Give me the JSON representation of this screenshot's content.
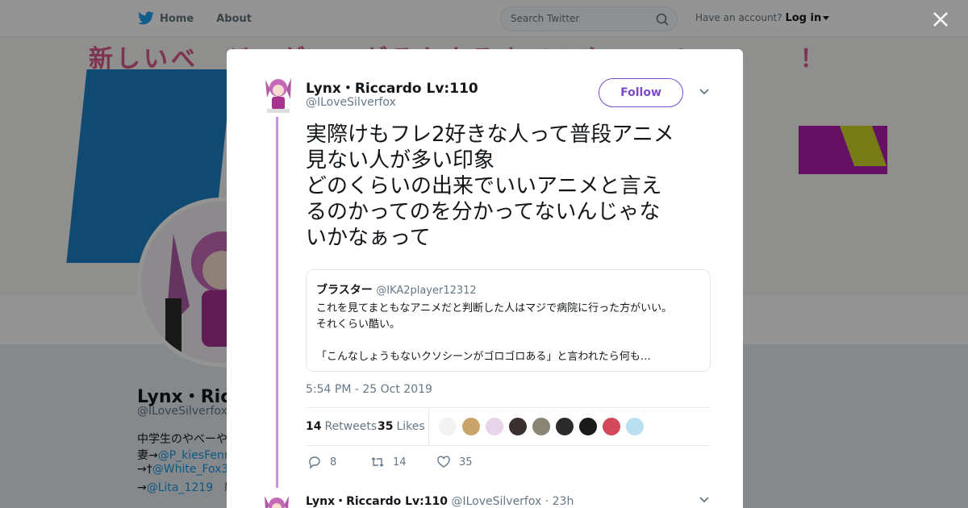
{
  "nav": {
    "home_label": "Home",
    "about_label": "About",
    "search_placeholder": "Search Twitter",
    "account_prompt": "Have an account?",
    "login_label": "Log in"
  },
  "background_profile": {
    "name": "Lynx・Ricc",
    "handle": "@ILoveSilverfox",
    "bio_lines": [
      {
        "text": "中学生のやべーや",
        "mention": ""
      },
      {
        "text": "妻→",
        "mention": "@P_kiesFenn"
      },
      {
        "text": "→†",
        "mention": "@White_Fox3"
      },
      {
        "text": "→",
        "mention": "@Lita_1219",
        "suffix": "　新"
      }
    ]
  },
  "tweet": {
    "author_name": "Lynx・Riccardo Lv:110",
    "author_handle": "@ILoveSilverfox",
    "follow_label": "Follow",
    "text_lines": [
      "実際けもフレ2好きな人って普段アニメ",
      "見ない人が多い印象",
      "どのくらいの出来でいいアニメと言え",
      "るのかってのを分かってないんじゃな",
      "いかなぁって"
    ],
    "quote": {
      "author_name": "ブラスター",
      "author_handle": "@IKA2player12312",
      "lines": [
        "これを見てまともなアニメだと判断した人はマジで病院に行った方がいい。",
        "それくらい酷い。",
        "",
        "「こんなしょうもないクソシーンがゴロゴロある」と言われたら何も…"
      ]
    },
    "timestamp": "5:54 PM - 25 Oct 2019",
    "retweets_count": "14",
    "retweets_label": "Retweets",
    "likes_count": "35",
    "likes_label": "Likes",
    "actions": {
      "reply_count": "8",
      "retweet_count": "14",
      "like_count": "35"
    }
  },
  "next_tweet": {
    "author_name": "Lynx・Riccardo Lv:110",
    "author_handle": "@ILoveSilverfox",
    "time": "· 23h"
  },
  "colors": {
    "twitter_blue": "#1da1f2",
    "follow_purple": "#794bc4",
    "thread_line": "#c791e6"
  }
}
